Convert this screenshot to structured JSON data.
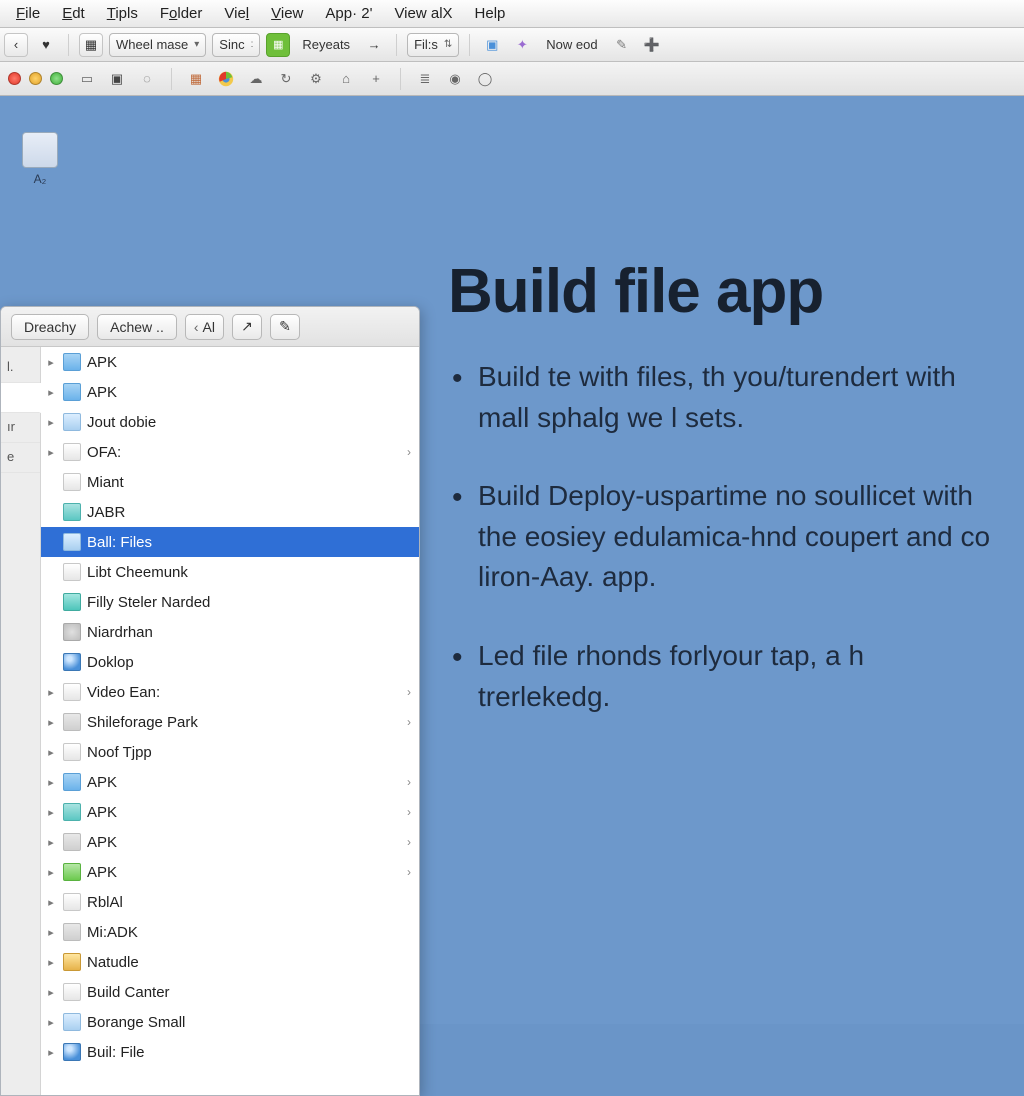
{
  "menubar": {
    "items": [
      "File",
      "Edt",
      "Tipls",
      "Folder",
      "Viel",
      "View",
      "App· 2'",
      "View alX",
      "Help"
    ]
  },
  "toolbar1": {
    "back": "‹",
    "heart": "♥",
    "grid": "▦",
    "wheel": "Wheel mase",
    "sinc": "Sinc",
    "reyeats": "Reyeats",
    "arrow": "→",
    "fills": "Fil:s",
    "nowod": "Now eod"
  },
  "toolbar2": {
    "icons": [
      "▭",
      "▣",
      "◌",
      "▥",
      "◐",
      "↺",
      "✦",
      "⚙",
      "⌂",
      "+",
      "≣",
      "⦿",
      "◯"
    ]
  },
  "desktop": {
    "icon_label": "A₂"
  },
  "finder": {
    "buttons": {
      "dreachy": "Dreachy",
      "achew": "Achew ..",
      "al": "Al"
    },
    "sidebar": [
      "l.",
      "",
      "ır",
      "e"
    ],
    "files": [
      {
        "icon": "ic-folder-blue",
        "label": "APK",
        "disc": true,
        "chev": false
      },
      {
        "icon": "ic-folder-blue",
        "label": "APK",
        "disc": true,
        "chev": false
      },
      {
        "icon": "ic-doc-blue",
        "label": "Jout dobie",
        "disc": true,
        "chev": false
      },
      {
        "icon": "ic-doc",
        "label": "OFA:",
        "disc": true,
        "chev": true
      },
      {
        "icon": "ic-doc",
        "label": "Miant",
        "disc": false,
        "chev": false
      },
      {
        "icon": "ic-folder-teal",
        "label": "JABR",
        "disc": false,
        "chev": false
      },
      {
        "icon": "ic-doc-blue",
        "label": "Ball: Files",
        "disc": false,
        "chev": false,
        "selected": true
      },
      {
        "icon": "ic-doc",
        "label": "Libt Cheemunk",
        "disc": false,
        "chev": false
      },
      {
        "icon": "ic-app-teal",
        "label": "Filly Steler Narded",
        "disc": false,
        "chev": false
      },
      {
        "icon": "ic-gear",
        "label": "Niardrhan",
        "disc": false,
        "chev": false
      },
      {
        "icon": "ic-globe",
        "label": "Doklop",
        "disc": false,
        "chev": false
      },
      {
        "icon": "ic-doc",
        "label": "Video Ean:",
        "disc": true,
        "chev": true
      },
      {
        "icon": "ic-app-gray",
        "label": "Shileforage Park",
        "disc": true,
        "chev": true
      },
      {
        "icon": "ic-doc",
        "label": "Noof Tjpp",
        "disc": true,
        "chev": false
      },
      {
        "icon": "ic-folder-blue",
        "label": "APK",
        "disc": true,
        "chev": true
      },
      {
        "icon": "ic-folder-teal",
        "label": "APK",
        "disc": true,
        "chev": true
      },
      {
        "icon": "ic-app-gray",
        "label": "APK",
        "disc": true,
        "chev": true
      },
      {
        "icon": "ic-app-green",
        "label": "APK",
        "disc": true,
        "chev": true
      },
      {
        "icon": "ic-doc",
        "label": "RblAl",
        "disc": true,
        "chev": false
      },
      {
        "icon": "ic-app-gray",
        "label": "Mi:ADK",
        "disc": true,
        "chev": false
      },
      {
        "icon": "ic-bag",
        "label": "Natudle",
        "disc": true,
        "chev": false
      },
      {
        "icon": "ic-doc",
        "label": "Build Canter",
        "disc": true,
        "chev": false
      },
      {
        "icon": "ic-doc-blue",
        "label": "Borange Small",
        "disc": true,
        "chev": false
      },
      {
        "icon": "ic-globe",
        "label": "Buil: File",
        "disc": true,
        "chev": false
      }
    ]
  },
  "panel": {
    "title": "Build file app",
    "bullets": [
      "Build te with files, th you/turendert with mall sphalg we l sets.",
      "Build Deploy-uspartime no soullicet with the eosiey edulamica-hnd coupert and co liron-Aay. app.",
      "Led file rhonds forlyour tap, a h trerlekedg."
    ]
  }
}
